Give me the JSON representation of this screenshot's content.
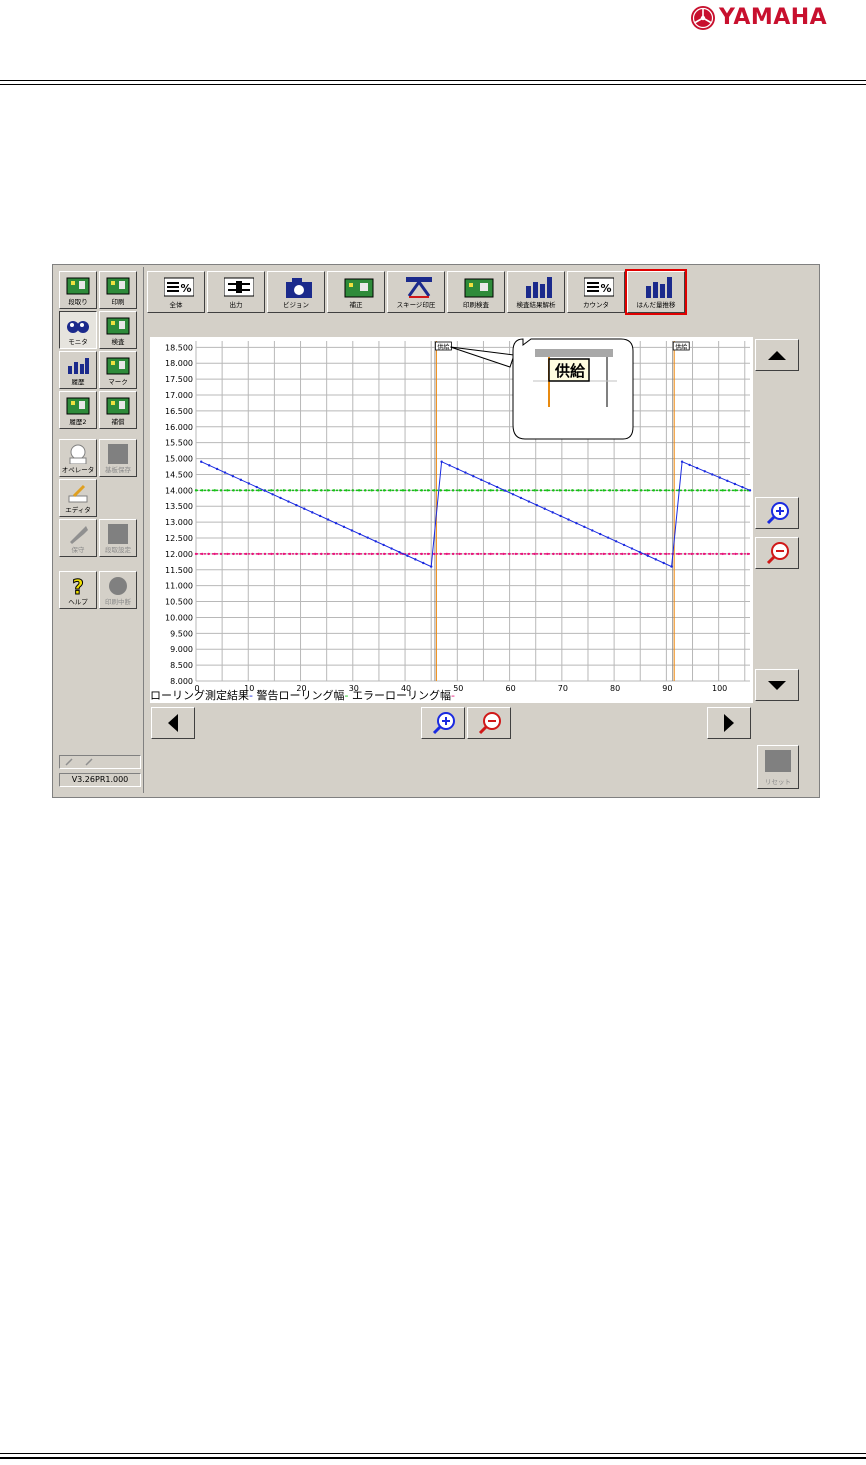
{
  "brand": {
    "name": "YAMAHA",
    "color": "#c8102e"
  },
  "left_panel": {
    "buttons": [
      {
        "label": "段取り",
        "icon": "setup-icon",
        "state": "normal"
      },
      {
        "label": "印刷",
        "icon": "print-icon",
        "state": "normal"
      },
      {
        "label": "モニタ",
        "icon": "monitor-icon",
        "state": "pressed"
      },
      {
        "label": "検査",
        "icon": "inspection-icon",
        "state": "normal"
      },
      {
        "label": "履歴",
        "icon": "history-icon",
        "state": "normal"
      },
      {
        "label": "マーク",
        "icon": "mark-icon",
        "state": "normal"
      },
      {
        "label": "履歴2",
        "icon": "history2-icon",
        "state": "normal"
      },
      {
        "label": "補償",
        "icon": "compensation-icon",
        "state": "normal"
      },
      {
        "label": "オペレータ",
        "icon": "operator-icon",
        "state": "normal"
      },
      {
        "label": "基板保存",
        "icon": "board-save-icon",
        "state": "dim"
      },
      {
        "label": "エディタ",
        "icon": "editor-icon",
        "state": "normal"
      },
      {
        "label": "保守",
        "icon": "maintenance-icon",
        "state": "dim"
      },
      {
        "label": "段取設定",
        "icon": "setup-settings-icon",
        "state": "dim"
      },
      {
        "label": "ヘルプ",
        "icon": "help-icon",
        "state": "normal"
      },
      {
        "label": "印刷中断",
        "icon": "print-stop-icon",
        "state": "dim"
      }
    ],
    "version": "V3.26PR1.000"
  },
  "top_tabs": [
    {
      "label": "全体",
      "icon": "percent-list-icon"
    },
    {
      "label": "出力",
      "icon": "output-icon"
    },
    {
      "label": "ビジョン",
      "icon": "camera-icon"
    },
    {
      "label": "補正",
      "icon": "board-icon"
    },
    {
      "label": "スキージ印圧",
      "icon": "squeegee-icon"
    },
    {
      "label": "印刷検査",
      "icon": "print-inspection-icon"
    },
    {
      "label": "検査結果解析",
      "icon": "bar-chart-icon"
    },
    {
      "label": "カウンタ",
      "icon": "counter-icon"
    },
    {
      "label": "はんだ量推移",
      "icon": "solder-trend-icon",
      "active": true
    }
  ],
  "reset_label": "リセット",
  "chart_data": {
    "type": "line",
    "x_ticks": [
      0,
      10,
      20,
      30,
      40,
      50,
      60,
      70,
      80,
      90,
      100
    ],
    "y_ticks": [
      "8.000",
      "8.500",
      "9.000",
      "9.500",
      "10.000",
      "10.500",
      "11.000",
      "11.500",
      "12.000",
      "12.500",
      "13.000",
      "13.500",
      "14.000",
      "14.500",
      "15.000",
      "15.500",
      "16.000",
      "16.500",
      "17.000",
      "17.500",
      "18.000",
      "18.500"
    ],
    "xlim": [
      0,
      106
    ],
    "ylim": [
      8.0,
      18.7
    ],
    "series": [
      {
        "name": "ローリング測定結果",
        "color": "#1a2ae0",
        "x": [
          1,
          45,
          47,
          91,
          93,
          106
        ],
        "y": [
          14.9,
          11.6,
          14.9,
          11.6,
          14.9,
          14.0
        ]
      },
      {
        "name": "警告ローリング幅",
        "color": "#16c016",
        "constant": 14.0
      },
      {
        "name": "エラーローリング幅",
        "color": "#e8147a",
        "constant": 12.0
      }
    ],
    "events": [
      {
        "x": 46,
        "label": "供給"
      },
      {
        "x": 91.5,
        "label": "供給"
      }
    ],
    "grid": true
  },
  "callout": {
    "label": "供給"
  }
}
